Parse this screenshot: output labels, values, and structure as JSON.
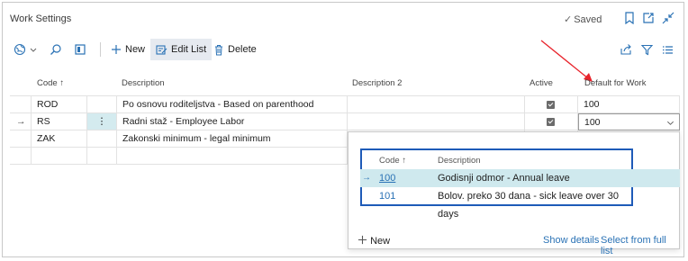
{
  "window": {
    "title": "Work Settings",
    "saved_label": "Saved",
    "icons": [
      "bookmark-icon",
      "open-new-window-icon",
      "collapse-icon"
    ]
  },
  "toolbar": {
    "new_label": "New",
    "edit_list_label": "Edit List",
    "delete_label": "Delete"
  },
  "grid": {
    "columns": {
      "code": "Code",
      "description": "Description",
      "description2": "Description 2",
      "active": "Active",
      "default_for_work": "Default for Work"
    },
    "sort_indicator": "↑",
    "row_menu_glyph": "⋮",
    "rows": [
      {
        "code": "ROD",
        "description": "Po osnovu roditeljstva - Based on parenthood",
        "description2": "",
        "active": true,
        "default_for_work": "100"
      },
      {
        "code": "RS",
        "description": "Radni staž - Employee Labor",
        "description2": "",
        "active": true,
        "default_for_work": "100",
        "current": true
      },
      {
        "code": "ZAK",
        "description": "Zakonski minimum - legal minimum",
        "description2": "",
        "active": null,
        "default_for_work": ""
      }
    ]
  },
  "lookup": {
    "columns": {
      "code": "Code",
      "description": "Description"
    },
    "rows": [
      {
        "code": "100",
        "description": "Godisnji odmor - Annual leave",
        "selected": true
      },
      {
        "code": "101",
        "description": "Bolov. preko 30 dana - sick leave over 30 days",
        "selected": false
      }
    ],
    "new_label": "New",
    "show_details_label": "Show details",
    "select_full_list_label": "Select from full list"
  },
  "colors": {
    "accent": "#2a72b5",
    "highlight_box": "#1e5bb8",
    "selected_row": "#cfe9ee",
    "annotation_arrow": "#e8232b"
  }
}
